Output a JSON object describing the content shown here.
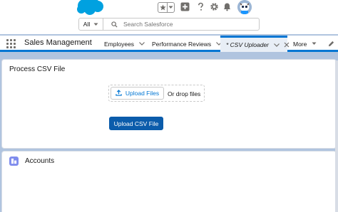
{
  "header": {
    "search_scope": "All",
    "search_placeholder": "Search Salesforce",
    "icons": [
      "salesforce-cloud-logo",
      "favorites-star-icon",
      "favorites-list-caret-icon",
      "global-actions-plus-icon",
      "help-question-icon",
      "setup-gear-icon",
      "notifications-bell-icon",
      "user-avatar-astro"
    ]
  },
  "nav": {
    "app_name": "Sales Management",
    "items": [
      {
        "label": "Employees"
      },
      {
        "label": "Performance Reviews"
      },
      {
        "label": "* CSV Uploader"
      },
      {
        "label": "More"
      }
    ]
  },
  "process_card": {
    "title": "Process CSV File",
    "upload_files_label": "Upload Files",
    "drop_label": "Or drop files",
    "upload_csv_label": "Upload CSV File"
  },
  "accounts_card": {
    "title": "Accounts"
  },
  "colors": {
    "brand_blue": "#0176d3",
    "button_blue": "#0b5cab",
    "background": "#b0c4df",
    "accounts_icon": "#7f8ced"
  }
}
